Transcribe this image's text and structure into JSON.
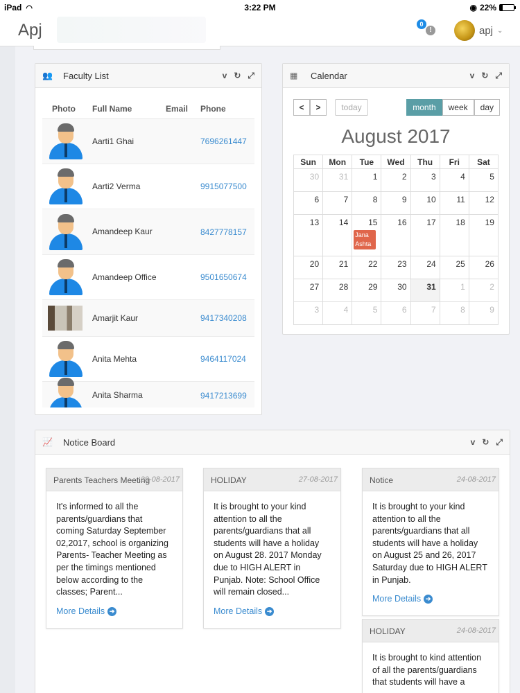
{
  "status": {
    "device": "iPad",
    "time": "3:22 PM",
    "battery": "22%",
    "battery_level": 0.22
  },
  "nav": {
    "brand": "Apj",
    "notif_count": "0",
    "notif_symbol": "!",
    "user": "apj"
  },
  "faculty": {
    "title": "Faculty List",
    "headers": {
      "photo": "Photo",
      "name": "Full Name",
      "email": "Email",
      "phone": "Phone"
    },
    "rows": [
      {
        "name": "Aarti1 Ghai",
        "phone": "7696261447"
      },
      {
        "name": "Aarti2 Verma",
        "phone": "9915077500"
      },
      {
        "name": "Amandeep Kaur",
        "phone": "8427778157"
      },
      {
        "name": "Amandeep Office",
        "phone": "9501650674"
      },
      {
        "name": "Amarjit Kaur",
        "phone": "9417340208"
      },
      {
        "name": "Anita Mehta",
        "phone": "9464117024"
      },
      {
        "name": "Anita Sharma",
        "phone": "9417213699"
      }
    ]
  },
  "calendar": {
    "title": "Calendar",
    "today_label": "today",
    "views": {
      "month": "month",
      "week": "week",
      "day": "day"
    },
    "month_title": "August 2017",
    "dow": [
      "Sun",
      "Mon",
      "Tue",
      "Wed",
      "Thu",
      "Fri",
      "Sat"
    ],
    "weeks": [
      [
        "30",
        "31",
        "1",
        "2",
        "3",
        "4",
        "5"
      ],
      [
        "6",
        "7",
        "8",
        "9",
        "10",
        "11",
        "12"
      ],
      [
        "13",
        "14",
        "15",
        "16",
        "17",
        "18",
        "19"
      ],
      [
        "20",
        "21",
        "22",
        "23",
        "24",
        "25",
        "26"
      ],
      [
        "27",
        "28",
        "29",
        "30",
        "31",
        "1",
        "2"
      ],
      [
        "3",
        "4",
        "5",
        "6",
        "7",
        "8",
        "9"
      ]
    ],
    "event": {
      "label1": "Jana",
      "label2": "Ashta"
    }
  },
  "notice": {
    "title": "Notice Board",
    "more_label": "More Details",
    "cards": [
      {
        "title": "Parents Teachers Meeting",
        "date": "29-08-2017",
        "body": "It's informed to all the parents/guardians that coming Saturday September 02,2017, school is organizing Parents- Teacher Meeting as per the timings mentioned below according to the classes; Parent..."
      },
      {
        "title": "HOLIDAY",
        "date": "27-08-2017",
        "body": "It is brought to your kind attention to all the parents/guardians that all students will have a holiday on August 28. 2017 Monday due to HIGH ALERT in Punjab. Note: School Office will remain closed..."
      },
      {
        "title": "Notice",
        "date": "24-08-2017",
        "body": "It is brought to your kind attention to all the parents/guardians that all students will have a holiday on August 25 and 26, 2017 Saturday due to HIGH ALERT in Punjab."
      },
      {
        "title": "HOLIDAY",
        "date": "24-08-2017",
        "body": "It is brought to kind attention of all the parents/guardians that students will have a"
      }
    ]
  },
  "icons": {
    "panel_collapse": "v",
    "panel_refresh": "↻",
    "panel_expand": "⤢",
    "faculty": "👥",
    "calendar": "▦",
    "notice": "📈",
    "prev": "<",
    "next": ">",
    "more_arrow": "➔",
    "caret": "⌄"
  }
}
